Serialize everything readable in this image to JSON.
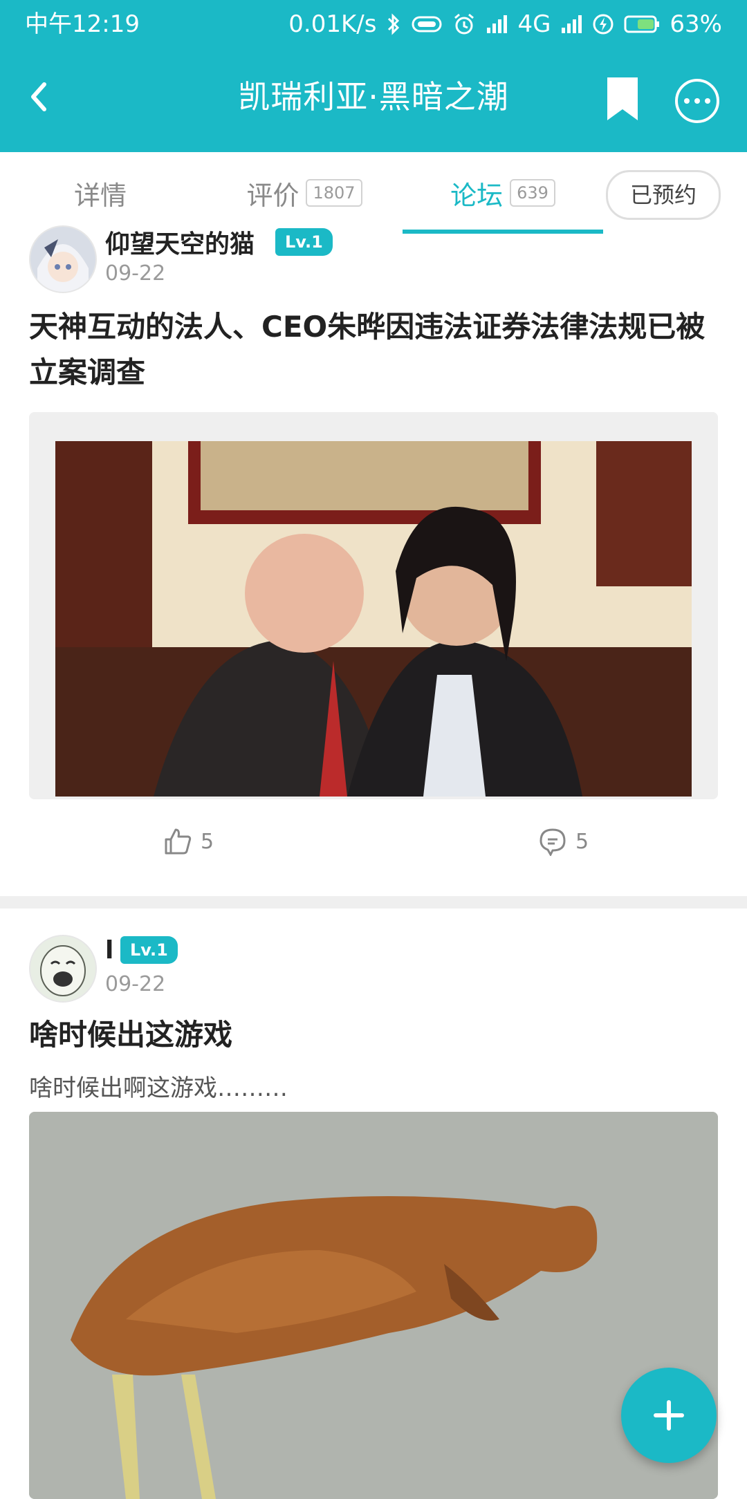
{
  "status_bar": {
    "time": "中午12:19",
    "network_speed": "0.01K/s",
    "network_type": "4G",
    "battery": "63%"
  },
  "toolbar": {
    "title": "凯瑞利亚·黑暗之潮",
    "icons": [
      "back-arrow-icon",
      "bookmark-icon",
      "more-icon"
    ]
  },
  "tabs": [
    {
      "label": "详情",
      "count": ""
    },
    {
      "label": "评价",
      "count": "1807"
    },
    {
      "label": "论坛",
      "count": "639",
      "active": true
    }
  ],
  "reserve_button": "已预约",
  "posts": [
    {
      "author": "仰望天空的猫",
      "level": "Lv.1",
      "date": "09-22",
      "title": "天神互动的法人、CEO朱晔因违法证券法律法规已被立案调查",
      "likes": "5",
      "comments": "5"
    },
    {
      "author": "l",
      "level": "Lv.1",
      "date": "09-22",
      "title": "啥时候出这游戏",
      "excerpt": "啥时候出啊这游戏………"
    }
  ],
  "colors": {
    "accent": "#1bb9c6",
    "divider": "#efefef",
    "text_primary": "#222222",
    "text_secondary": "#9a9a9a"
  }
}
